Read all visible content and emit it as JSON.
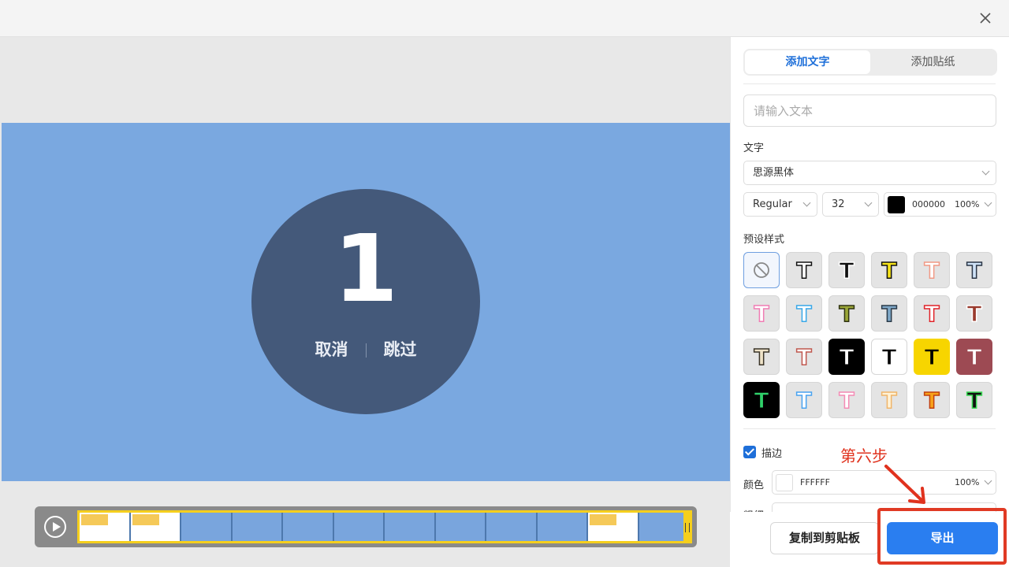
{
  "window": {
    "close_icon": "close-icon"
  },
  "preview": {
    "countdown": "1",
    "cancel_label": "取消",
    "skip_label": "跳过",
    "background_color": "#7aa8e0",
    "circle_color": "#44597a"
  },
  "timeline": {
    "play_icon": "play-icon",
    "frame_count": 12
  },
  "panel": {
    "tabs": [
      {
        "label": "添加文字",
        "active": true
      },
      {
        "label": "添加贴纸",
        "active": false
      }
    ],
    "text_input": {
      "placeholder": "请输入文本",
      "value": ""
    },
    "text_section_label": "文字",
    "font_family": "思源黑体",
    "font_weight": "Regular",
    "font_size": "32",
    "font_color_hex": "000000",
    "font_color": "#000000",
    "font_opacity": "100%",
    "preset_section_label": "预设样式",
    "presets": [
      {
        "name": "none",
        "fill": "",
        "stroke": "",
        "bg": ""
      },
      {
        "name": "white-black-outline",
        "fill": "#ffffff",
        "stroke": "#111111",
        "bg": "#e4e4e4"
      },
      {
        "name": "black",
        "fill": "#111111",
        "stroke": "#ffffff",
        "bg": "#e4e4e4"
      },
      {
        "name": "yellow-black-outline",
        "fill": "#f5e21a",
        "stroke": "#111111",
        "bg": "#e4e4e4"
      },
      {
        "name": "white-salmon-outline",
        "fill": "#ffffff",
        "stroke": "#f19a86",
        "bg": "#e4e4e4"
      },
      {
        "name": "lightblue-dark-outline",
        "fill": "#cfe2f7",
        "stroke": "#2a3545",
        "bg": "#e4e4e4"
      },
      {
        "name": "white-pink-outline",
        "fill": "#ffffff",
        "stroke": "#f07db4",
        "bg": "#e4e4e4"
      },
      {
        "name": "white-blue-outline",
        "fill": "#ffffff",
        "stroke": "#39a8e8",
        "bg": "#e4e4e4"
      },
      {
        "name": "olive-dark-outline",
        "fill": "#9aa638",
        "stroke": "#2f3312",
        "bg": "#e4e4e4"
      },
      {
        "name": "steelblue-dark-outline",
        "fill": "#7fa8c8",
        "stroke": "#2b3a48",
        "bg": "#e4e4e4"
      },
      {
        "name": "white-red-outline",
        "fill": "#ffffff",
        "stroke": "#e0242a",
        "bg": "#e4e4e4"
      },
      {
        "name": "brown",
        "fill": "#9a3b2e",
        "stroke": "#ffffff",
        "bg": "#e4e4e4"
      },
      {
        "name": "beige-dark-outline",
        "fill": "#efe3c8",
        "stroke": "#3a3428",
        "bg": "#e4e4e4"
      },
      {
        "name": "white-rose-outline",
        "fill": "#ffffff",
        "stroke": "#c0584f",
        "bg": "#e4e4e4"
      },
      {
        "name": "white-on-black",
        "fill": "#ffffff",
        "stroke": "#000000",
        "bg": "#000000"
      },
      {
        "name": "black-on-white",
        "fill": "#000000",
        "stroke": "#ffffff",
        "bg": "#ffffff"
      },
      {
        "name": "black-on-yellow",
        "fill": "#000000",
        "stroke": "#f7d500",
        "bg": "#f7d500"
      },
      {
        "name": "white-on-maroon",
        "fill": "#ffffff",
        "stroke": "#9d4a53",
        "bg": "#9d4a53"
      },
      {
        "name": "green-on-black",
        "fill": "#2fd16a",
        "stroke": "#000000",
        "bg": "#000000"
      },
      {
        "name": "white-blue-gradient",
        "fill": "#ffffff",
        "stroke": "#4aa3f0",
        "bg": "#e4e4e4"
      },
      {
        "name": "white-pink-gradient",
        "fill": "#ffffff",
        "stroke": "#f48bb5",
        "bg": "#e4e4e4"
      },
      {
        "name": "cream-orange-outline",
        "fill": "#fff2d6",
        "stroke": "#f0b56a",
        "bg": "#e4e4e4"
      },
      {
        "name": "orange-gradient",
        "fill": "#f7a21b",
        "stroke": "#c1400f",
        "bg": "#e4e4e4"
      },
      {
        "name": "black-green-shadow",
        "fill": "#111111",
        "stroke": "#3ddc57",
        "bg": "#e4e4e4"
      }
    ],
    "stroke_enabled": true,
    "stroke_label": "描边",
    "stroke_color_label": "颜色",
    "stroke_color_hex": "FFFFFF",
    "stroke_color": "#ffffff",
    "stroke_opacity": "100%",
    "stroke_width_label_partial": "粗细"
  },
  "annotation": {
    "step_label": "第六步",
    "color": "#e0321e"
  },
  "buttons": {
    "copy_label": "复制到剪贴板",
    "export_label": "导出"
  }
}
